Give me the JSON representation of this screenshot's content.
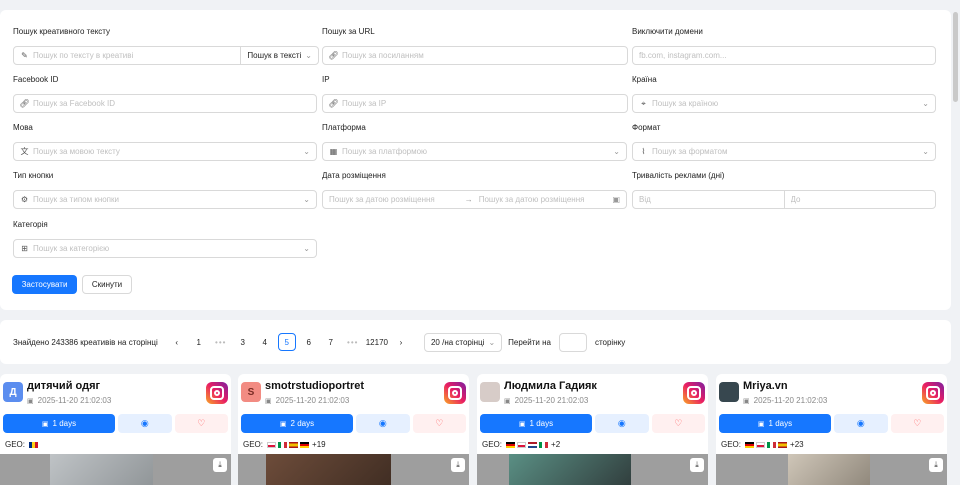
{
  "filters": {
    "creative_text": {
      "label": "Пошук креативного тексту",
      "placeholder": "Пошук по тексту в креативі",
      "mode": "Пошук в тексті"
    },
    "url": {
      "label": "Пошук за URL",
      "placeholder": "Пошук за посиланням"
    },
    "exclude_domains": {
      "label": "Виключити домени",
      "placeholder": "fb.com, instagram.com..."
    },
    "facebook_id": {
      "label": "Facebook ID",
      "placeholder": "Пошук за Facebook ID"
    },
    "ip": {
      "label": "IP",
      "placeholder": "Пошук за IP"
    },
    "country": {
      "label": "Країна",
      "placeholder": "Пошук за країною"
    },
    "language": {
      "label": "Мова",
      "placeholder": "Пошук за мовою тексту"
    },
    "platform": {
      "label": "Платформа",
      "placeholder": "Пошук за платформою"
    },
    "format": {
      "label": "Формат",
      "placeholder": "Пошук за форматом"
    },
    "button_type": {
      "label": "Тип кнопки",
      "placeholder": "Пошук за типом кнопки"
    },
    "date": {
      "label": "Дата розміщення",
      "from_placeholder": "Пошук за датою розміщення",
      "to_placeholder": "Пошук за датою розміщення"
    },
    "duration": {
      "label": "Тривалість реклами (дні)",
      "from_placeholder": "Від",
      "to_placeholder": "До"
    },
    "category": {
      "label": "Категорія",
      "placeholder": "Пошук за категорією"
    },
    "apply_label": "Застосувати",
    "reset_label": "Скинути"
  },
  "pagination": {
    "found_text": "Знайдено 243386 креативів на сторінці",
    "prev": "‹",
    "next": "›",
    "pages": [
      "1",
      "3",
      "4",
      "5",
      "6",
      "7",
      "12170"
    ],
    "dots": "•••",
    "current": "5",
    "page_size": "20 /на сторінці",
    "jump_label": "Перейти на",
    "jump_suffix": "сторінку"
  },
  "cards": [
    {
      "avatar_letter": "Д",
      "avatar_color": "#5b8def",
      "name": "дитячий одяг",
      "date": "2025-11-20 21:02:03",
      "days": "1 days",
      "geo_label": "GEO:",
      "geo_more": "",
      "flags": [
        [
          "#002b7f",
          "#fcd116",
          "#ce1126"
        ]
      ]
    },
    {
      "avatar_letter": "S",
      "avatar_color": "#f28b82",
      "name": "smotrstudioportret",
      "date": "2025-11-20 21:02:03",
      "days": "2 days",
      "geo_label": "GEO:",
      "geo_more": "+19",
      "flags": [
        [
          "#ffffff",
          "#ffffff",
          "#dc143c"
        ],
        [
          "#009246",
          "#ffffff",
          "#ce2b37"
        ],
        [
          "#aa151b",
          "#f1bf00",
          "#aa151b"
        ],
        [
          "#000000",
          "#dd0000",
          "#ffce00"
        ]
      ]
    },
    {
      "avatar_letter": "",
      "avatar_color": "#d7ccc8",
      "name": "Людмила Гадияк",
      "date": "2025-11-20 21:02:03",
      "days": "1 days",
      "geo_label": "GEO:",
      "geo_more": "+2",
      "flags": [
        [
          "#000000",
          "#dd0000",
          "#ffce00"
        ],
        [
          "#ffffff",
          "#ffffff",
          "#dc143c"
        ],
        [
          "#ae1c28",
          "#ffffff",
          "#21468b"
        ],
        [
          "#009246",
          "#ffffff",
          "#ce2b37"
        ]
      ]
    },
    {
      "avatar_letter": "",
      "avatar_color": "#37474f",
      "name": "Mriya.vn",
      "date": "2025-11-20 21:02:03",
      "days": "1 days",
      "geo_label": "GEO:",
      "geo_more": "+23",
      "flags": [
        [
          "#000000",
          "#dd0000",
          "#ffce00"
        ],
        [
          "#ffffff",
          "#ffffff",
          "#dc143c"
        ],
        [
          "#009246",
          "#ffffff",
          "#ce2b37"
        ],
        [
          "#aa151b",
          "#f1bf00",
          "#aa151b"
        ]
      ]
    }
  ]
}
